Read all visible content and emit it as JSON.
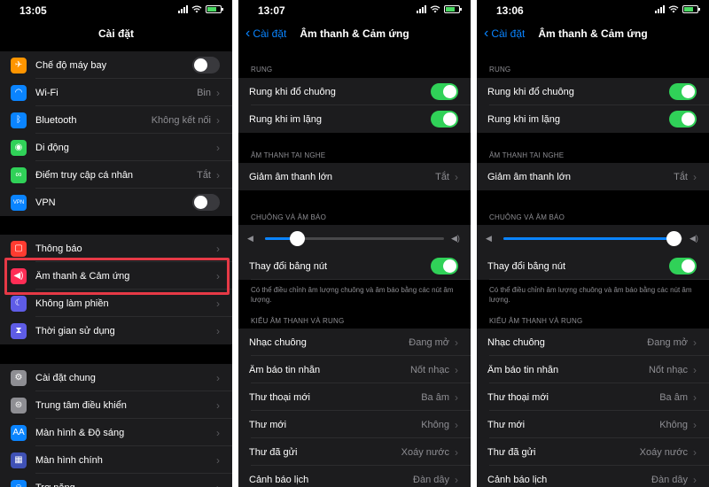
{
  "phone1": {
    "time": "13:05",
    "title": "Cài đặt",
    "group1": [
      {
        "label": "Chế độ máy bay",
        "icon": "✈",
        "color": "#ff9500",
        "toggle": false
      },
      {
        "label": "Wi-Fi",
        "icon": "◠",
        "color": "#0a84ff",
        "value": "Bin"
      },
      {
        "label": "Bluetooth",
        "icon": "ᛒ",
        "color": "#0a84ff",
        "value": "Không kết nối"
      },
      {
        "label": "Di động",
        "icon": "◉",
        "color": "#30d158",
        "value": ""
      },
      {
        "label": "Điểm truy cập cá nhân",
        "icon": "∞",
        "color": "#30d158",
        "value": "Tắt"
      },
      {
        "label": "VPN",
        "icon": "VPN",
        "color": "#0a84ff",
        "toggle": false
      }
    ],
    "group2": [
      {
        "label": "Thông báo",
        "icon": "▢",
        "color": "#ff3b30"
      },
      {
        "label": "Âm thanh & Cảm ứng",
        "icon": "◀)",
        "color": "#ff2d55"
      },
      {
        "label": "Không làm phiền",
        "icon": "☾",
        "color": "#5e5ce6"
      },
      {
        "label": "Thời gian sử dụng",
        "icon": "⧗",
        "color": "#5e5ce6"
      }
    ],
    "group3": [
      {
        "label": "Cài đặt chung",
        "icon": "⚙",
        "color": "#8e8e93"
      },
      {
        "label": "Trung tâm điều khiển",
        "icon": "⊜",
        "color": "#8e8e93"
      },
      {
        "label": "Màn hình & Độ sáng",
        "icon": "AA",
        "color": "#0a84ff"
      },
      {
        "label": "Màn hình chính",
        "icon": "▦",
        "color": "#3f51b5"
      },
      {
        "label": "Trợ năng",
        "icon": "☺",
        "color": "#0a84ff"
      }
    ]
  },
  "sound": {
    "back_label": "Cài đặt",
    "title": "Âm thanh & Cảm ứng",
    "rung_header": "RUNG",
    "rung_ring": "Rung khi đổ chuông",
    "rung_silent": "Rung khi im lặng",
    "headphone_header": "ÂM THANH TAI NGHE",
    "reduce_loud": "Giảm âm thanh lớn",
    "reduce_loud_value": "Tắt",
    "ringer_header": "CHUÔNG VÀ ÂM BÁO",
    "change_with_buttons": "Thay đổi bằng nút",
    "footnote": "Có thể điều chỉnh âm lượng chuông và âm báo bằng các nút âm lượng.",
    "patterns_header": "KIỂU ÂM THANH VÀ RUNG",
    "patterns": [
      {
        "label": "Nhạc chuông",
        "value": "Đang mở"
      },
      {
        "label": "Âm báo tin nhắn",
        "value": "Nốt nhạc"
      },
      {
        "label": "Thư thoại mới",
        "value": "Ba âm"
      },
      {
        "label": "Thư mới",
        "value": "Không"
      },
      {
        "label": "Thư đã gửi",
        "value": "Xoáy nước"
      },
      {
        "label": "Cảnh báo lịch",
        "value": "Đàn dây"
      }
    ]
  },
  "phone2": {
    "time": "13:07",
    "volume": 0.18
  },
  "phone3": {
    "time": "13:06",
    "volume": 0.95
  }
}
